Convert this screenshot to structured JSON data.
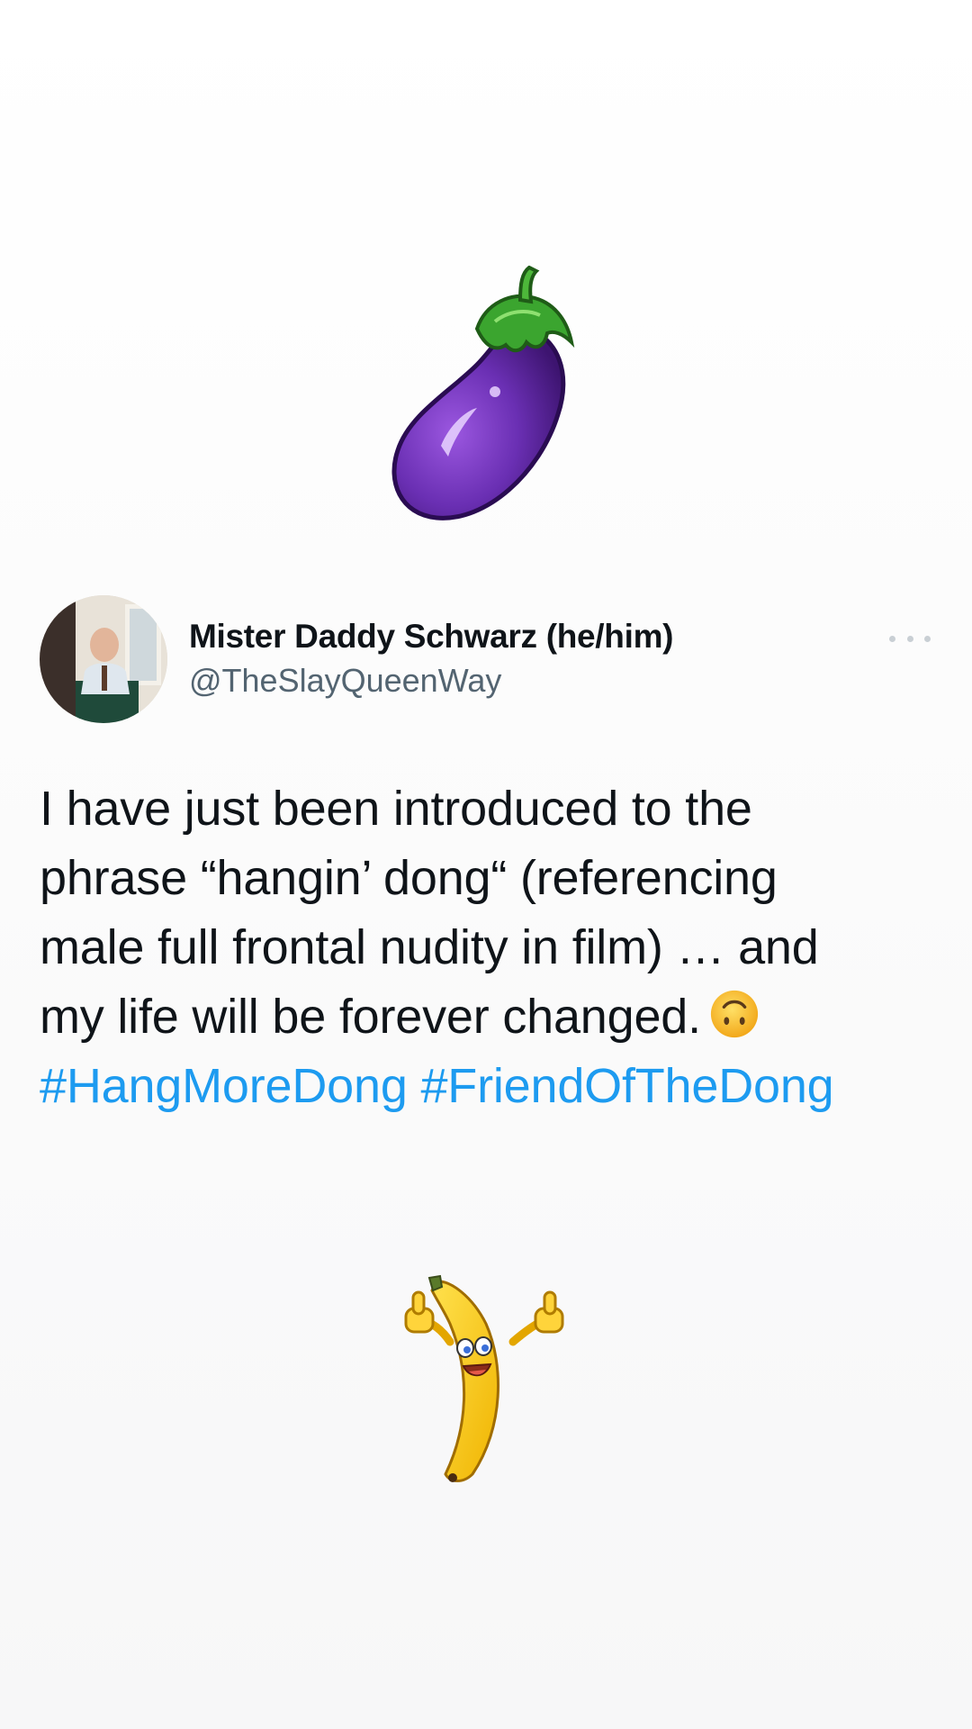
{
  "stickers": {
    "top": "eggplant-sticker",
    "bottom": "thumbs-up-banana-sticker"
  },
  "tweet": {
    "display_name": "Mister Daddy Schwarz (he/him)",
    "handle": "@TheSlayQueenWay",
    "text_lines": [
      "I have just been introduced to the",
      "phrase “hangin’ dong“ (referencing",
      "male full frontal nudity in film) … and",
      "my life will be forever changed."
    ],
    "emoji": "upside-down-face-emoji",
    "hashtags": [
      "#HangMoreDong",
      "#FriendOfTheDong"
    ]
  },
  "colors": {
    "text": "#0f1419",
    "handle": "#536471",
    "hashtag": "#1d9bf0",
    "eggplant": "#6a2fb3",
    "banana": "#f5c518"
  }
}
